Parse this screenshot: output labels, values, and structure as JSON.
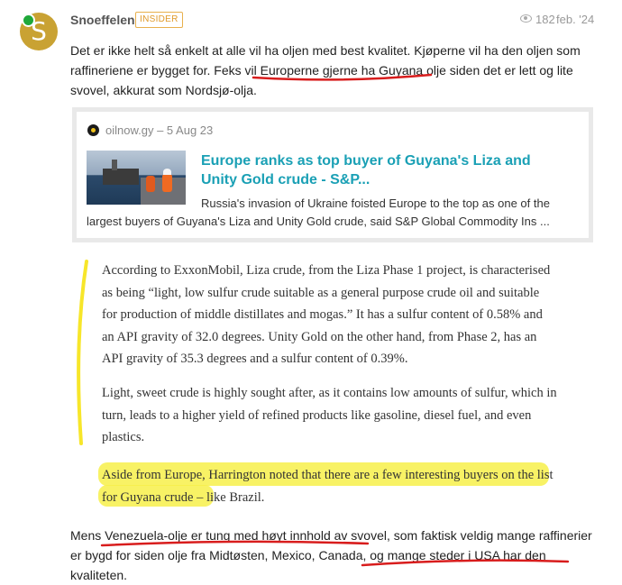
{
  "post": {
    "username": "Snoeffelen",
    "avatar_letter": "S",
    "badge": "INSIDER",
    "views": "182",
    "date": "feb. '24",
    "paragraph_1": "Det er ikke helt så enkelt at alle vil ha oljen med best kvalitet. Kjøperne vil ha den oljen som raffineriene er bygget for. Feks vil Europerne gjerne ha Guyana olje siden det er lett og lite svovel, akkurat som Nordsjø-olja.",
    "paragraph_3": "Mens Venezuela-olje er tung med høyt innhold av svovel, som faktisk veldig mange raffinerier er bygd for siden olje fra Midtøsten, Mexico, Canada, og mange steder i USA har den kvaliteten."
  },
  "onebox": {
    "source": "oilnow.gy – 5 Aug 23",
    "title": "Europe ranks as top buyer of Guyana's Liza and Unity Gold crude - S&P...",
    "excerpt": "Russia's invasion of Ukraine foisted Europe to the top as one of the largest buyers of Guyana's Liza and Unity Gold crude, said S&P Global Commodity Ins ..."
  },
  "quote": {
    "p1": "According to ExxonMobil, Liza crude, from the Liza Phase 1 project, is characterised as being “light, low sulfur crude suitable as a general purpose crude oil and suitable for production of middle distillates and mogas.” It has a sulfur content of 0.58% and an API gravity of 32.0 degrees. Unity Gold on the other hand, from Phase 2, has an API gravity of 35.3 degrees and a sulfur content of 0.39%.",
    "p2": "Light, sweet crude is highly sought after, as it contains low amounts of sulfur, which in turn, leads to a higher yield of refined products like gasoline, diesel fuel, and even plastics.",
    "p3": "Aside from Europe, Harrington noted that there are a few interesting buyers on the list for Guyana crude – like Brazil."
  },
  "colors": {
    "link_title": "#1aa0b5",
    "badge": "#e09a2a",
    "online": "#1fa83a",
    "annotation_red": "#d81d1d",
    "annotation_yellow": "#f7f04a"
  }
}
